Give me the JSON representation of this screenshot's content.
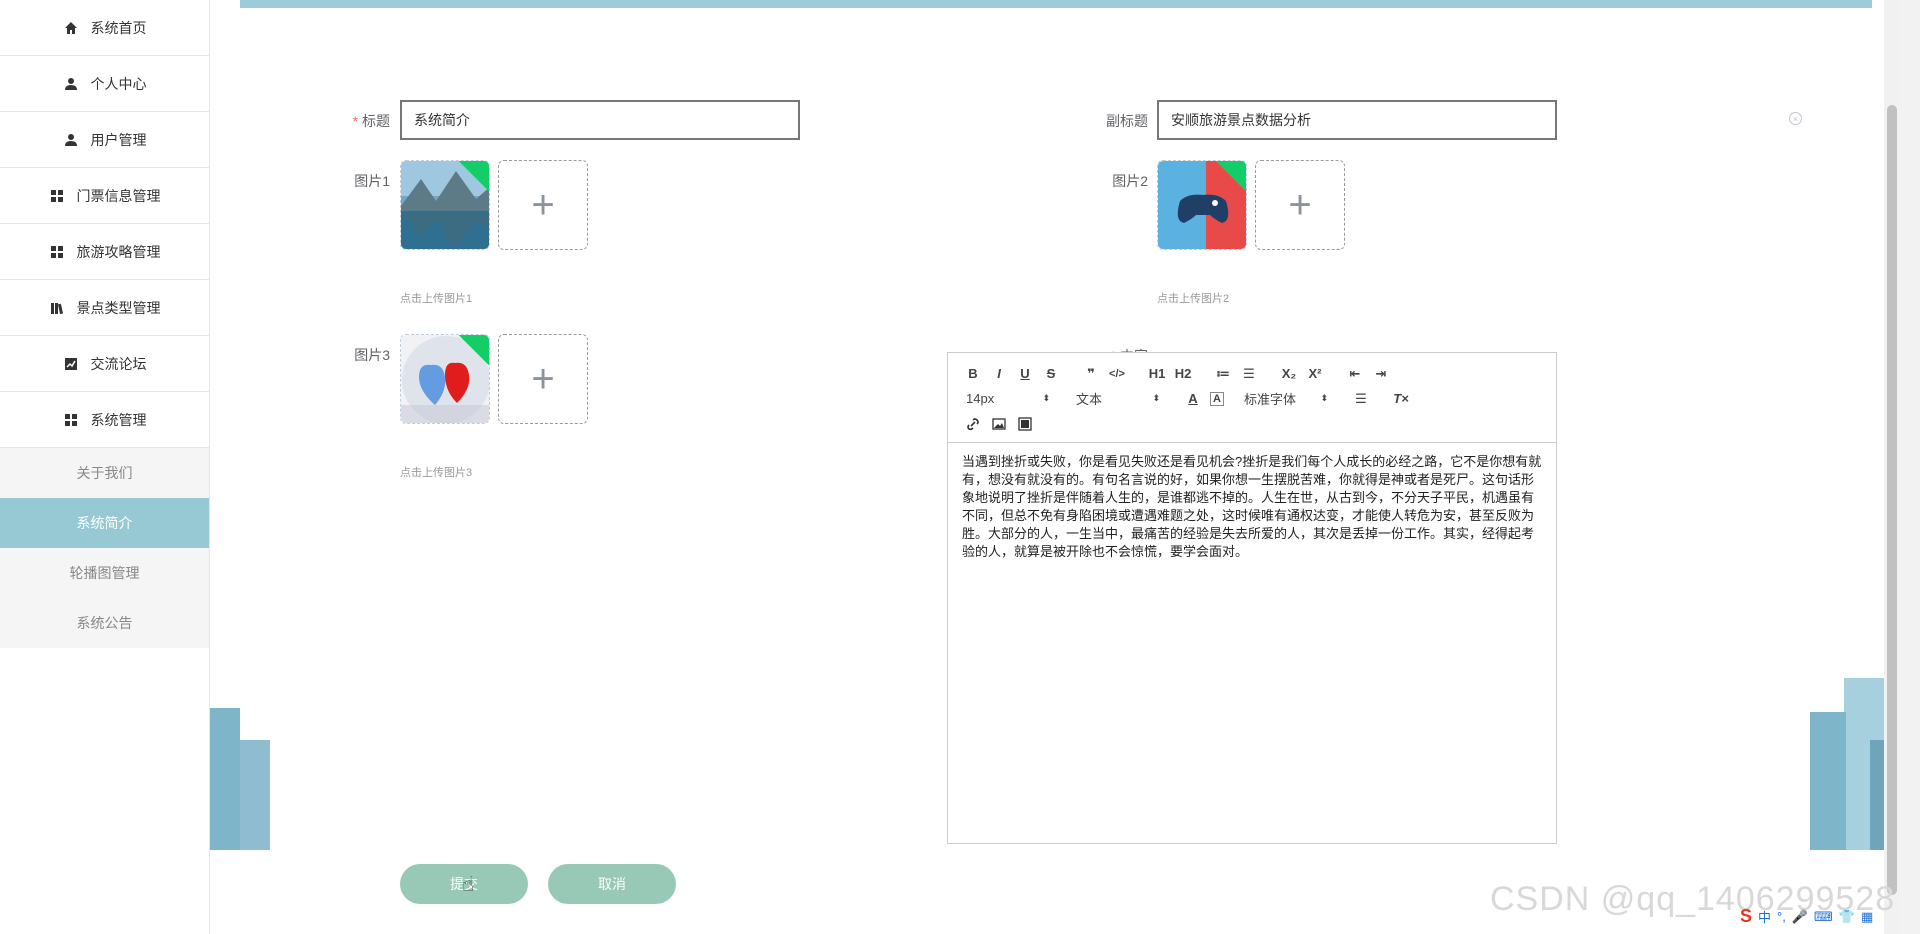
{
  "sidebar": {
    "items": [
      {
        "label": "系统首页",
        "icon": "home-icon"
      },
      {
        "label": "个人中心",
        "icon": "user-icon"
      },
      {
        "label": "用户管理",
        "icon": "user-icon"
      },
      {
        "label": "门票信息管理",
        "icon": "grid-icon"
      },
      {
        "label": "旅游攻略管理",
        "icon": "grid-icon"
      },
      {
        "label": "景点类型管理",
        "icon": "book-icon"
      },
      {
        "label": "交流论坛",
        "icon": "chart-icon"
      },
      {
        "label": "系统管理",
        "icon": "grid-icon"
      }
    ],
    "sub_items": [
      {
        "label": "关于我们",
        "active": false
      },
      {
        "label": "系统简介",
        "active": true
      },
      {
        "label": "轮播图管理",
        "active": false
      },
      {
        "label": "系统公告",
        "active": false
      }
    ]
  },
  "form": {
    "title_label": "标题",
    "title_value": "系统简介",
    "subtitle_label": "副标题",
    "subtitle_value": "安顺旅游景点数据分析",
    "img1_label": "图片1",
    "img1_hint": "点击上传图片1",
    "img2_label": "图片2",
    "img2_hint": "点击上传图片2",
    "img3_label": "图片3",
    "img3_hint": "点击上传图片3",
    "content_label": "内容",
    "uploader_plus": "+",
    "clear_symbol": "×"
  },
  "editor": {
    "toolbar_row1": [
      "B",
      "I",
      "U",
      "S",
      "❞",
      "</>",
      "H1",
      "H2",
      "≔",
      "☰",
      "X₂",
      "X²",
      "⇤",
      "⇥"
    ],
    "font_size": "14px",
    "text_style": "文本",
    "font_family": "标准字体",
    "content": "当遇到挫折或失败，你是看见失败还是看见机会?挫折是我们每个人成长的必经之路，它不是你想有就有，想没有就没有的。有句名言说的好，如果你想一生摆脱苦难，你就得是神或者是死尸。这句话形象地说明了挫折是伴随着人生的，是谁都逃不掉的。人生在世，从古到今，不分天子平民，机遇虽有不同，但总不免有身陷困境或遭遇难题之处，这时候唯有通权达变，才能使人转危为安，甚至反败为胜。大部分的人，一生当中，最痛苦的经验是失去所爱的人，其次是丢掉一份工作。其实，经得起考验的人，就算是被开除也不会惊慌，要学会面对。"
  },
  "buttons": {
    "submit": "提交",
    "cancel": "取消"
  },
  "watermark": "CSDN @qq_1406299528",
  "colors": {
    "accent": "#96c9d3",
    "button": "#98c9b7",
    "deco": "#7fb5c8",
    "badge": "#13ce66",
    "required": "#f56c6c"
  }
}
